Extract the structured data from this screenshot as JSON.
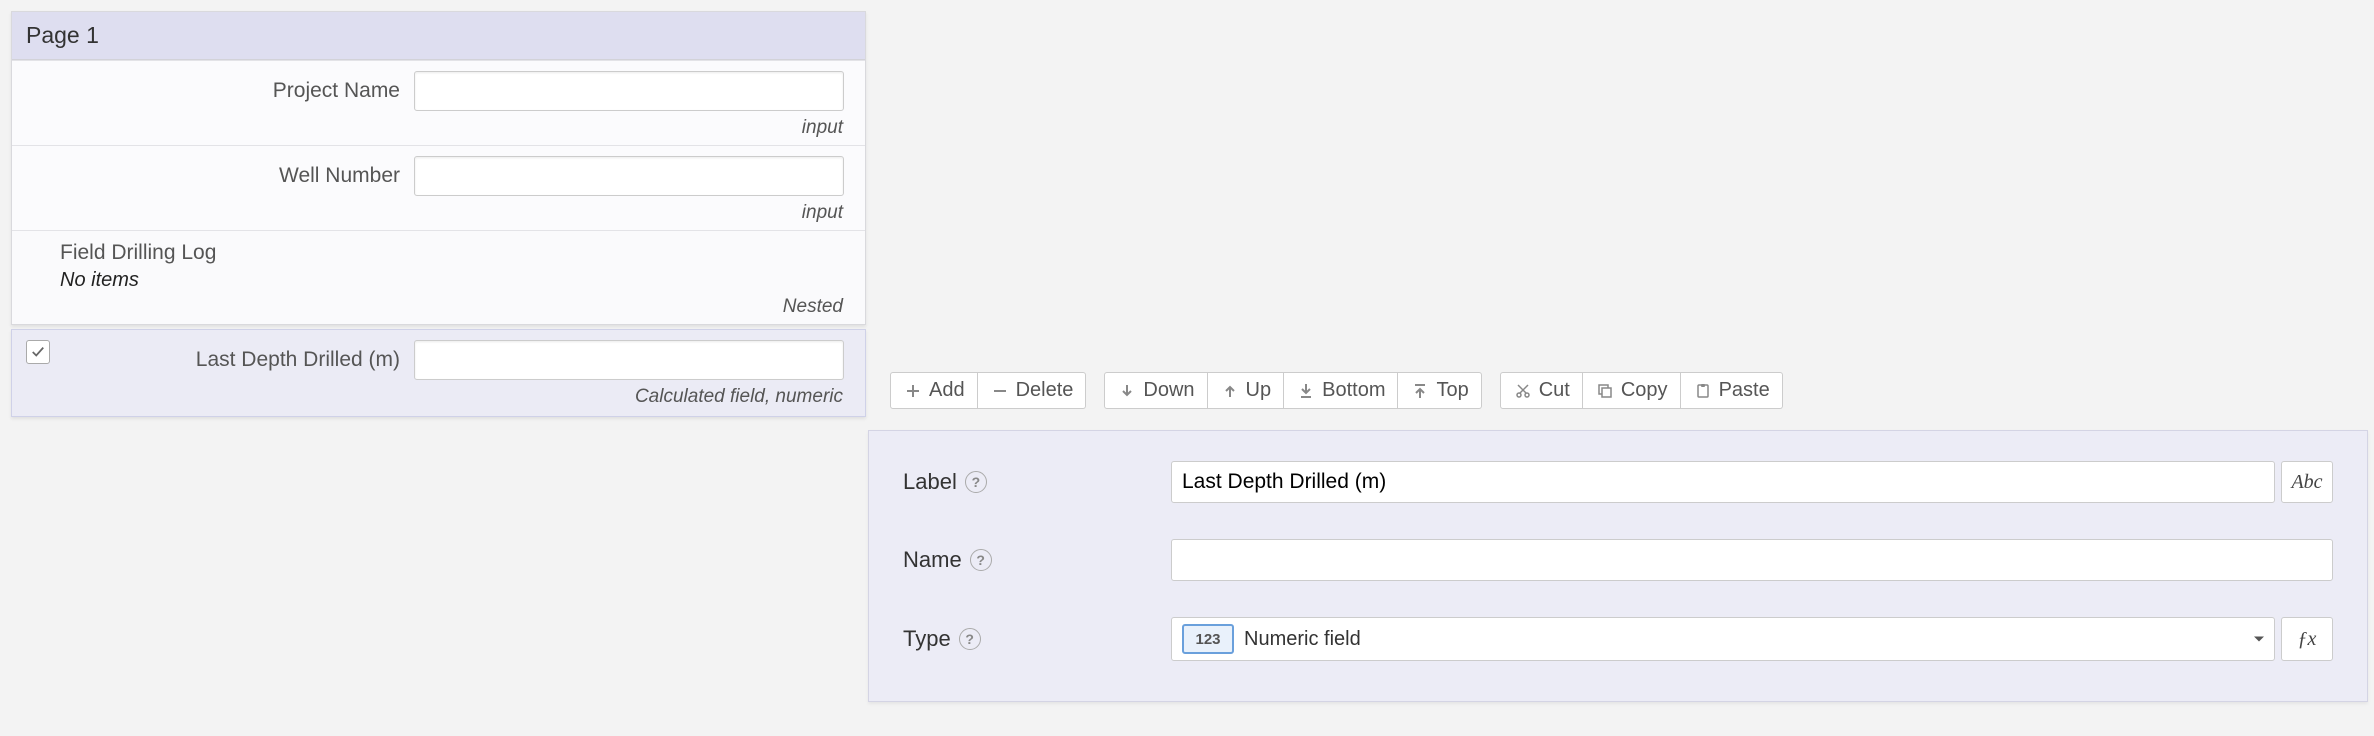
{
  "page": {
    "title": "Page 1",
    "fields": [
      {
        "label": "Project Name",
        "value": "",
        "caption": "input"
      },
      {
        "label": "Well Number",
        "value": "",
        "caption": "input"
      }
    ],
    "nested": {
      "title": "Field Drilling Log",
      "emptyText": "No items",
      "caption": "Nested"
    }
  },
  "selected": {
    "checked": true,
    "label": "Last Depth Drilled (m)",
    "value": "",
    "caption": "Calculated field, numeric"
  },
  "toolbar": {
    "add": "Add",
    "delete": "Delete",
    "down": "Down",
    "up": "Up",
    "bottom": "Bottom",
    "top": "Top",
    "cut": "Cut",
    "copy": "Copy",
    "paste": "Paste"
  },
  "props": {
    "labelTitle": "Label",
    "labelValue": "Last Depth Drilled (m)",
    "abcSuffix": "Abc",
    "nameTitle": "Name",
    "nameValue": "",
    "typeTitle": "Type",
    "typeBadge": "123",
    "typeText": "Numeric field",
    "fx": "ƒx"
  }
}
